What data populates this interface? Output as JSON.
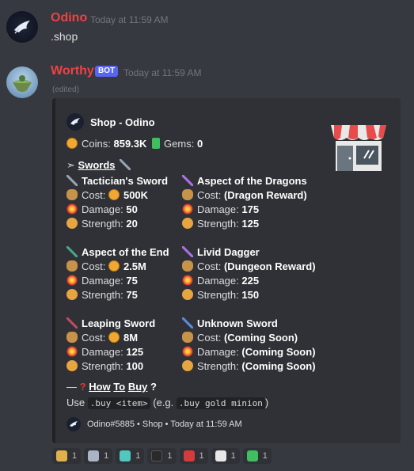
{
  "messages": [
    {
      "username": "Odino",
      "timestamp": "Today at 11:59 AM",
      "text": ".shop",
      "name_color": "#ed4245"
    },
    {
      "username": "Worthy",
      "badge": "BOT",
      "timestamp": "Today at 11:59 AM",
      "edited": "(edited)",
      "name_color": "#ed4245"
    }
  ],
  "embed": {
    "author": "Shop - Odino",
    "coins_label": "Coins:",
    "coins_value": "859.3K",
    "gems_label": "Gems:",
    "gems_value": "0",
    "section_arrow": "➣",
    "section_title": "Swords",
    "items": [
      {
        "name": "Tactician's Sword",
        "cost_label": "Cost:",
        "cost": "500K",
        "coin": true,
        "damage_label": "Damage:",
        "damage": "50",
        "strength_label": "Strength:",
        "strength": "20",
        "color": "blue-gray"
      },
      {
        "name": "Aspect of the Dragons",
        "cost_label": "Cost:",
        "cost": "(Dragon Reward)",
        "coin": false,
        "damage_label": "Damage:",
        "damage": "175",
        "strength_label": "Strength:",
        "strength": "125",
        "color": "purple"
      },
      {
        "name": "Aspect of the End",
        "cost_label": "Cost:",
        "cost": "2.5M",
        "coin": true,
        "damage_label": "Damage:",
        "damage": "75",
        "strength_label": "Strength:",
        "strength": "75",
        "color": "green"
      },
      {
        "name": "Livid Dagger",
        "cost_label": "Cost:",
        "cost": "(Dungeon Reward)",
        "coin": false,
        "damage_label": "Damage:",
        "damage": "225",
        "strength_label": "Strength:",
        "strength": "150",
        "color": "purple"
      },
      {
        "name": "Leaping Sword",
        "cost_label": "Cost:",
        "cost": "8M",
        "coin": true,
        "damage_label": "Damage:",
        "damage": "125",
        "strength_label": "Strength:",
        "strength": "100",
        "color": "red"
      },
      {
        "name": "Unknown Sword",
        "cost_label": "Cost:",
        "cost": "(Coming Soon)",
        "coin": false,
        "damage_label": "Damage:",
        "damage": "(Coming Soon)",
        "strength_label": "Strength:",
        "strength": "(Coming Soon)",
        "color": "blue"
      }
    ],
    "howto_prefix": "—",
    "howto_title_1": "How",
    "howto_title_2": "To",
    "howto_title_3": "Buy",
    "use_prefix": "Use",
    "use_code": ".buy <item>",
    "use_mid": "(e.g.",
    "use_example": ".buy gold minion",
    "use_suffix": ")",
    "footer": "Odino#5885 • Shop • Today at 11:59 AM"
  },
  "reactions": [
    {
      "icon": "shop-icon",
      "count": "1",
      "color": "#e0b04a"
    },
    {
      "icon": "swords-icon",
      "count": "1",
      "color": "#aab4c4"
    },
    {
      "icon": "chestplate-icon",
      "count": "1",
      "color": "#4fc9c0"
    },
    {
      "icon": "armor-icon",
      "count": "1",
      "color": "#2a2a2a"
    },
    {
      "icon": "red-dice-icon",
      "count": "1",
      "color": "#d43c3c"
    },
    {
      "icon": "white-dice-icon",
      "count": "1",
      "color": "#e8e8e8"
    },
    {
      "icon": "gem-icon",
      "count": "1",
      "color": "#3fbf5f"
    }
  ]
}
